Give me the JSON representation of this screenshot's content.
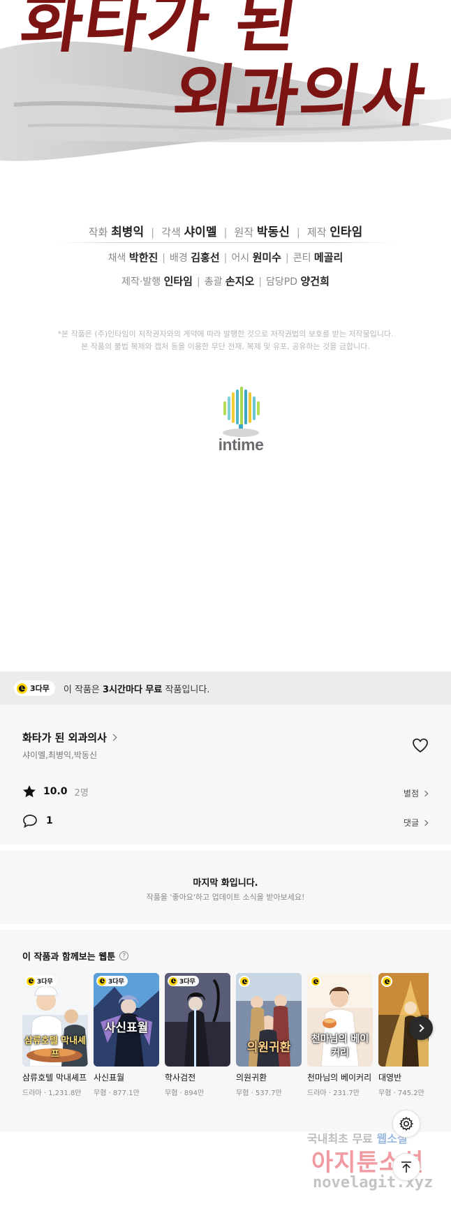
{
  "comic_page": {
    "title_line1": "화타가 된",
    "title_line2": "외과의사",
    "credits_row1": [
      {
        "role": "작화",
        "name": "최병익"
      },
      {
        "role": "각색",
        "name": "샤이멜"
      },
      {
        "role": "원작",
        "name": "박동신"
      },
      {
        "role": "제작",
        "name": "인타임"
      }
    ],
    "credits_row2": [
      {
        "role": "채색",
        "name": "박한진"
      },
      {
        "role": "배경",
        "name": "김홍선"
      },
      {
        "role": "어시",
        "name": "원미수"
      },
      {
        "role": "콘티",
        "name": "메골리"
      }
    ],
    "credits_row3": [
      {
        "role": "제작·발행",
        "name": "인타임"
      },
      {
        "role": "총괄",
        "name": "손지오"
      },
      {
        "role": "담당PD",
        "name": "양건희"
      }
    ],
    "separator": "|",
    "copyright_line1": "*본 작품은 (주)인타임이 저작권자와의 계약에 따라 발행한 것으로 저작권법의 보호를 받는 저작물입니다.",
    "copyright_line2": "본 작품의 불법 복제와 캡처 등을 이용한 무단 전재, 복제 및 유포, 공유하는 것을 금합니다.",
    "logo_text": "intime"
  },
  "banner": {
    "badge": "3다무",
    "text_before": "이 작품은 ",
    "text_bold": "3시간마다 무료",
    "text_after": " 작품입니다."
  },
  "work": {
    "title": "화타가 된 외과의사",
    "authors": "샤이멜,최병익,박동신",
    "rating": "10.0",
    "rating_count": "2명",
    "rating_link": "별점",
    "comment_count": "1",
    "comment_link": "댓글"
  },
  "last_episode": {
    "title": "마지막 화입니다.",
    "subtitle": "작품을 '좋아요'하고 업데이트 소식을 받아보세요!"
  },
  "recommendations": {
    "title": "이 작품과 함께보는 웹툰",
    "help": "?",
    "badge": "3다무",
    "items": [
      {
        "name": "삼류호텔 막내셰프",
        "meta": "드라마 · 1,231.8만",
        "cover_text": "삼류호텔 막내셰프"
      },
      {
        "name": "사신표월",
        "meta": "무협 · 877.1만",
        "cover_text": "사신표월"
      },
      {
        "name": "학사검전",
        "meta": "무협 · 894만",
        "cover_text": "학사검전"
      },
      {
        "name": "의원귀환",
        "meta": "무협 · 537.7만",
        "cover_text": "의원귀환"
      },
      {
        "name": "천마님의 베이커리",
        "meta": "드라마 · 231.7만",
        "cover_text": "천마님의 베이커리"
      },
      {
        "name": "대영반",
        "meta": "무협 · 745.2만",
        "cover_text": ""
      }
    ]
  },
  "watermark": {
    "line1_a": "국내최초 무료 ",
    "line1_b": "웹소설",
    "line2": "아지툰소설",
    "line3": "novelagit.xyz"
  },
  "colors": {
    "accent_yellow": "#ffd400",
    "title_red": "#7b1413"
  }
}
